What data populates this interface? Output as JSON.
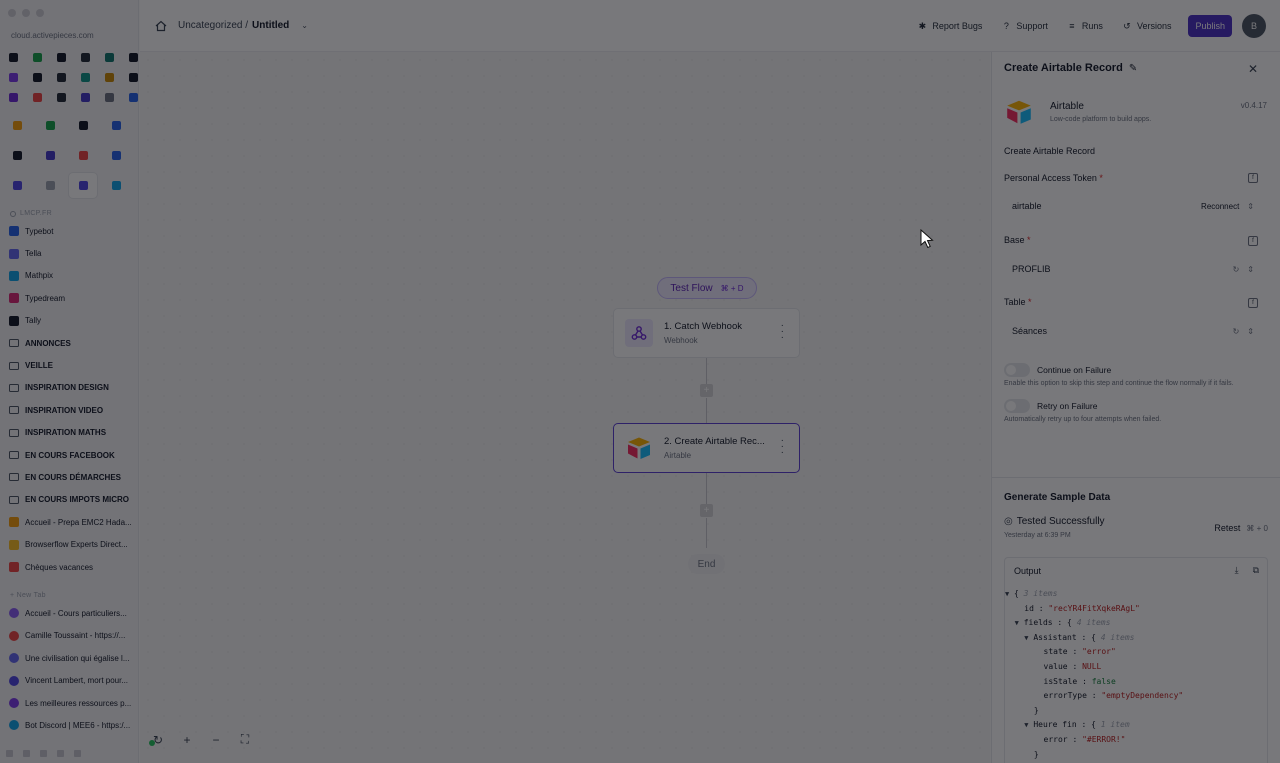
{
  "browser": {
    "url": "cloud.activepieces.com",
    "favorites_row_colors": [
      "#111827",
      "#16a34a",
      "#111827",
      "#1f2937",
      "#0f766e",
      "#111827",
      "#7c3aed",
      "#111827",
      "#1f2937",
      "#0d9488",
      "#ca8a04",
      "#111827",
      "#6d28d9",
      "#ef4444",
      "#1f2937",
      "#4338ca",
      "#6b7280",
      "#2563eb"
    ],
    "pinned_colors": [
      "#f59e0b",
      "#16a34a",
      "#111827",
      "#2563eb",
      "#111827",
      "#4338ca",
      "#ef4444",
      "#2563eb",
      "#4f46e5",
      "#9ca3af",
      "#4f46e5",
      "#0ea5e9"
    ],
    "section_label": "LMCP.FR",
    "items": [
      {
        "label": "Typebot",
        "icon": "typebot-icon",
        "color": "#2563eb",
        "bold": false,
        "folder": false
      },
      {
        "label": "Tella",
        "icon": "tella-icon",
        "color": "#6366f1",
        "bold": false,
        "folder": false
      },
      {
        "label": "Mathpix",
        "icon": "mathpix-icon",
        "color": "#0ea5e9",
        "bold": false,
        "folder": false
      },
      {
        "label": "Typedream",
        "icon": "typedream-icon",
        "color": "#db2777",
        "bold": false,
        "folder": false
      },
      {
        "label": "Tally",
        "icon": "tally-icon",
        "color": "#111827",
        "bold": false,
        "folder": false
      },
      {
        "label": "ANNONCES",
        "icon": "folder-icon",
        "bold": true,
        "folder": true
      },
      {
        "label": "VEILLE",
        "icon": "folder-icon",
        "bold": true,
        "folder": true
      },
      {
        "label": "INSPIRATION DESIGN",
        "icon": "folder-icon",
        "bold": true,
        "folder": true
      },
      {
        "label": "INSPIRATION VIDEO",
        "icon": "folder-icon",
        "bold": true,
        "folder": true
      },
      {
        "label": "INSPIRATION MATHS",
        "icon": "folder-icon",
        "bold": true,
        "folder": true
      },
      {
        "label": "EN COURS FACEBOOK",
        "icon": "folder-icon",
        "bold": true,
        "folder": true
      },
      {
        "label": "EN COURS DÉMARCHES",
        "icon": "folder-icon",
        "bold": true,
        "folder": true
      },
      {
        "label": "EN COURS IMPOTS MICRO",
        "icon": "folder-icon",
        "bold": true,
        "folder": true
      },
      {
        "label": "Accueil - Prepa EMC2 Hada...",
        "icon": "prepa-icon",
        "color": "#f59e0b",
        "bold": false,
        "folder": false
      },
      {
        "label": "Browserflow Experts Direct...",
        "icon": "browserflow-icon",
        "color": "#fbbf24",
        "bold": false,
        "folder": false
      },
      {
        "label": "Chèques vacances",
        "icon": "cheques-icon",
        "color": "#ef4444",
        "bold": false,
        "folder": false
      }
    ],
    "new_tab_label": "+ New Tab",
    "tabs": [
      {
        "label": "Accueil - Cours particuliers...",
        "color": "#8b5cf6"
      },
      {
        "label": "Camille Toussaint - https://...",
        "color": "#ef4444"
      },
      {
        "label": "Une civilisation qui égalise l...",
        "color": "#6366f1"
      },
      {
        "label": "Vincent Lambert, mort pour...",
        "color": "#4f46e5"
      },
      {
        "label": "Les meilleures ressources p...",
        "color": "#7c3aed"
      },
      {
        "label": "Bot Discord | MEE6 - https:/...",
        "color": "#0ea5e9"
      }
    ]
  },
  "header": {
    "breadcrumb_folder": "Uncategorized /",
    "flow_name": "Untitled",
    "report_bugs": "Report Bugs",
    "support": "Support",
    "runs": "Runs",
    "versions": "Versions",
    "publish": "Publish",
    "avatar_initial": "B"
  },
  "canvas": {
    "test_flow": "Test Flow",
    "test_flow_shortcut": "⌘ + D",
    "nodes": [
      {
        "title": "1. Catch Webhook",
        "subtitle": "Webhook"
      },
      {
        "title": "2. Create Airtable Rec...",
        "subtitle": "Airtable"
      }
    ],
    "end": "End"
  },
  "panel": {
    "title": "Create Airtable Record",
    "piece_name": "Airtable",
    "piece_description": "Low-code platform to build apps.",
    "piece_version": "v0.4.17",
    "action_name": "Create Airtable Record",
    "token_label": "Personal Access Token",
    "token_value": "airtable",
    "reconnect": "Reconnect",
    "base_label": "Base",
    "base_value": "PROFLIB",
    "table_label": "Table",
    "table_value": "Séances",
    "continue_label": "Continue on Failure",
    "continue_desc": "Enable this option to skip this step and continue the flow normally if it fails.",
    "retry_label": "Retry on Failure",
    "retry_desc": "Automatically retry up to four attempts when failed.",
    "required_mark": "*",
    "sample_title": "Generate Sample Data",
    "tested": "Tested Successfully",
    "tested_time": "Yesterday at 6:39 PM",
    "retest": "Retest",
    "retest_shortcut": "⌘ + 0",
    "output_label": "Output"
  },
  "output_json": {
    "root_count": "3 items",
    "id_key": "id",
    "id_value": "\"recYR4FitXqkeRAgL\"",
    "fields_key": "fields",
    "fields_count": "4 items",
    "assistant_key": "Assistant",
    "assistant_count": "4 items",
    "state_key": "state",
    "state_value": "\"error\"",
    "value_key": "value",
    "value_value": "NULL",
    "isstale_key": "isStale",
    "isstale_value": "false",
    "errortype_key": "errorType",
    "errortype_value": "\"emptyDependency\"",
    "heure_key": "Heure fin",
    "heure_count": "1 item",
    "error_key": "error",
    "error_value": "\"#ERROR!\""
  }
}
